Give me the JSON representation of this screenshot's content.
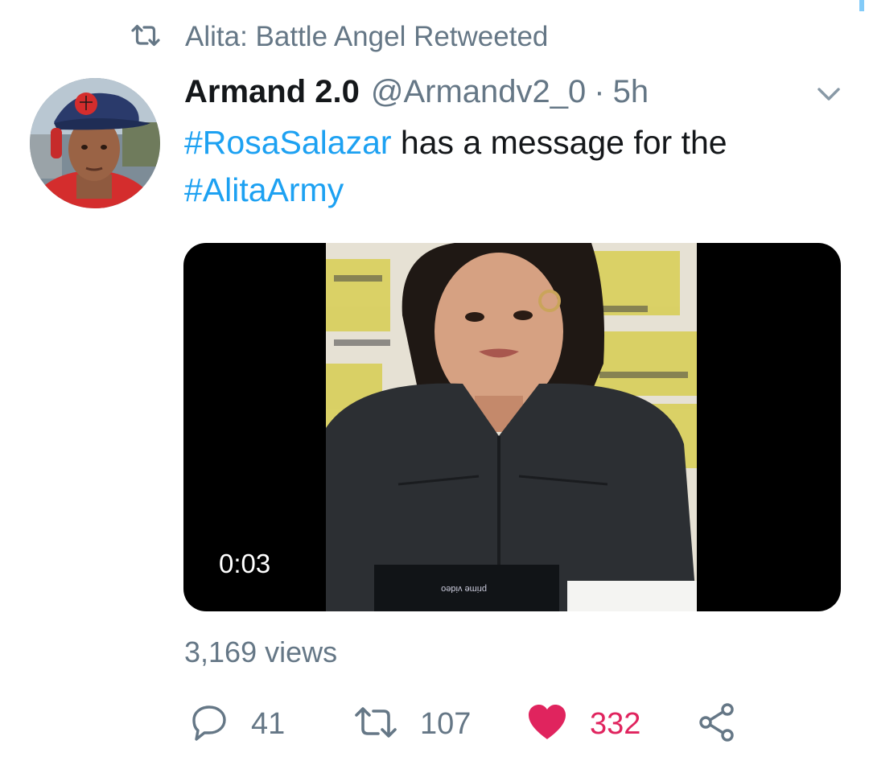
{
  "colors": {
    "accent": "#1da1f2",
    "secondary_text": "#657786",
    "like_active": "#e0245e",
    "primary_text": "#14171a"
  },
  "retweet_context": {
    "icon": "retweet-icon",
    "text": "Alita: Battle Angel Retweeted"
  },
  "tweet": {
    "author_name": "Armand 2.0",
    "handle": "@Armandv2_0",
    "separator": "·",
    "time": "5h",
    "text_hashtag_1": "#RosaSalazar",
    "text_body": " has a message for the ",
    "text_hashtag_2": "#AlitaArmy",
    "media": {
      "type": "video",
      "duration": "0:03"
    },
    "views": "3,169 views",
    "actions": {
      "reply_count": "41",
      "retweet_count": "107",
      "like_count": "332",
      "liked": true
    }
  }
}
